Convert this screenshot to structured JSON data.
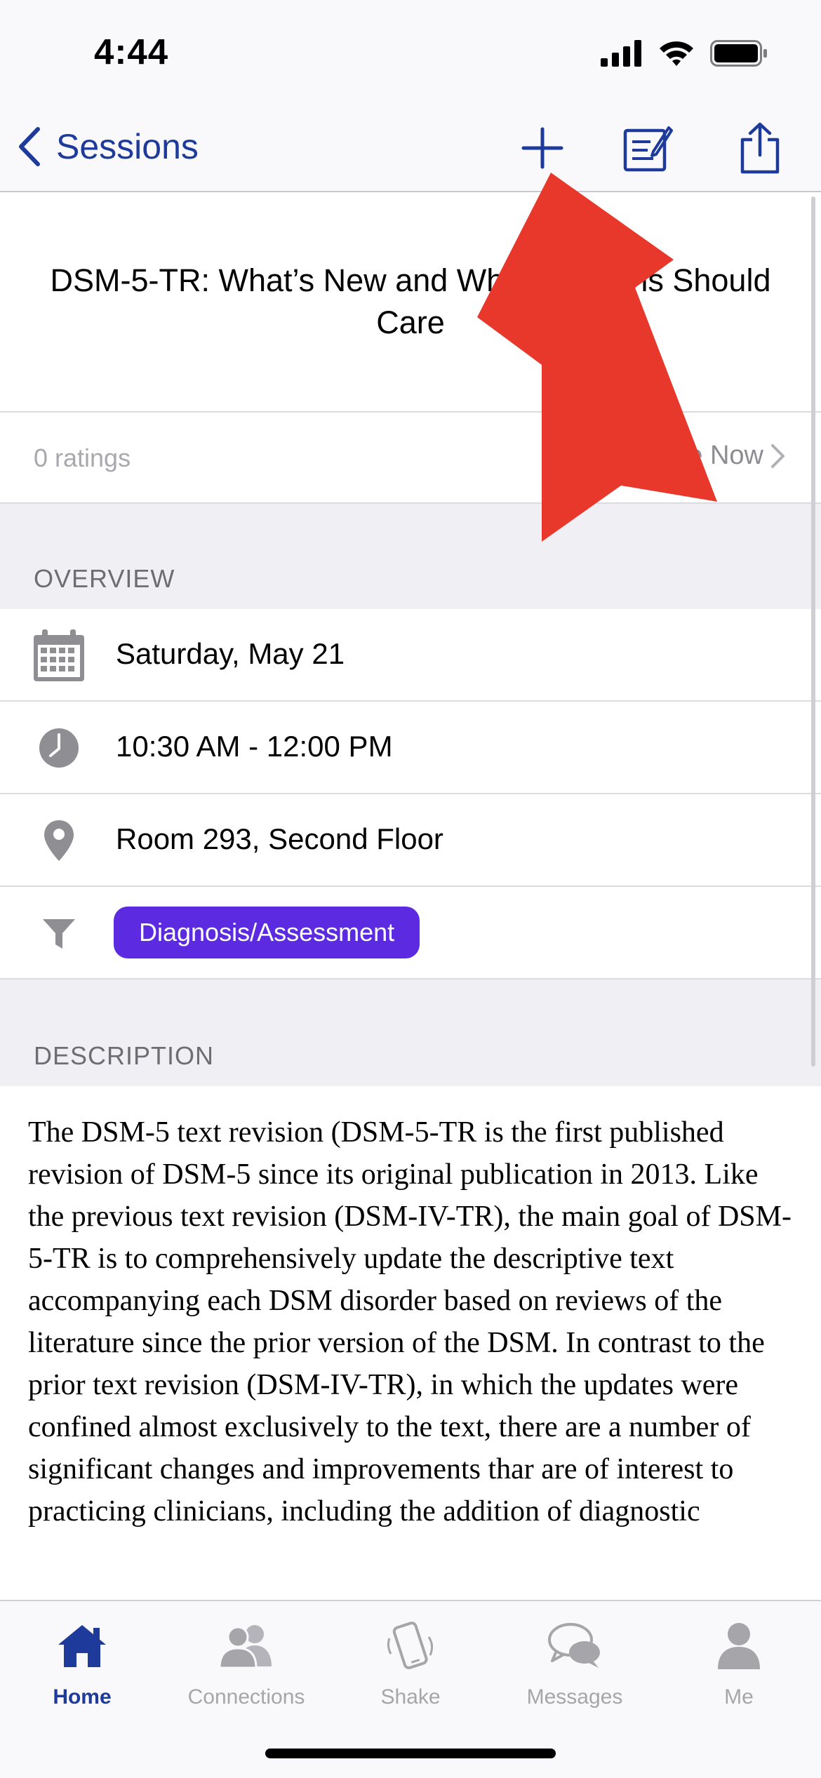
{
  "status_bar": {
    "time": "4:44"
  },
  "nav": {
    "back_label": "Sessions"
  },
  "session": {
    "title": "DSM-5-TR: What’s New and Why Clinicians Should Care",
    "ratings_label": "0 ratings",
    "rate_label": "Rate Now"
  },
  "overview": {
    "header": "OVERVIEW",
    "date": "Saturday, May 21",
    "time": "10:30 AM - 12:00 PM",
    "location": "Room 293, Second Floor",
    "track": "Diagnosis/Assessment"
  },
  "description": {
    "header": "DESCRIPTION",
    "text": "The DSM-5 text revision (DSM-5-TR is the first published revision of DSM-5 since its original publication in 2013. Like the previous text revision (DSM-IV-TR), the main goal of DSM-5-TR is to comprehensively update the descriptive text accompanying each DSM disorder based on reviews of the literature since the prior version of the DSM. In contrast to the prior text revision (DSM-IV-TR), in which the updates were confined almost exclusively to the text, there are a number of significant changes and improvements thar are of interest to practicing clinicians, including the addition of diagnostic"
  },
  "tabs": [
    {
      "label": "Home",
      "icon": "home-icon"
    },
    {
      "label": "Connections",
      "icon": "connections-icon"
    },
    {
      "label": "Shake",
      "icon": "shake-icon"
    },
    {
      "label": "Messages",
      "icon": "messages-icon"
    },
    {
      "label": "Me",
      "icon": "person-icon"
    }
  ],
  "colors": {
    "accent": "#1e3a9a",
    "track_badge": "#5c2ae0",
    "annotation_arrow": "#e8382c",
    "icon_gray": "#8e8e93"
  }
}
